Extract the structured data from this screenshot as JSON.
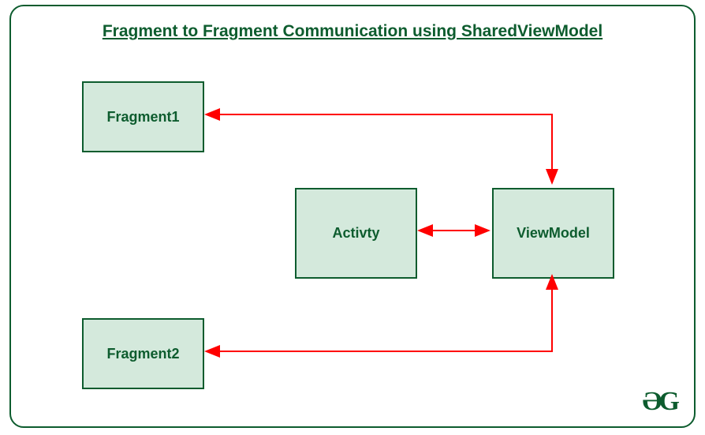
{
  "title": "Fragment to Fragment Communication using SharedViewModel",
  "boxes": {
    "fragment1": "Fragment1",
    "fragment2": "Fragment2",
    "activity": "Activty",
    "viewmodel": "ViewModel"
  },
  "logo": "ƏG",
  "colors": {
    "border": "#0d5c2e",
    "box_fill": "#d4e9dc",
    "arrow": "#ff0000"
  },
  "arrows": [
    {
      "from": "viewmodel",
      "to": "fragment1",
      "bidirectional": true
    },
    {
      "from": "viewmodel",
      "to": "fragment2",
      "bidirectional": true
    },
    {
      "from": "activity",
      "to": "viewmodel",
      "bidirectional": true
    }
  ]
}
